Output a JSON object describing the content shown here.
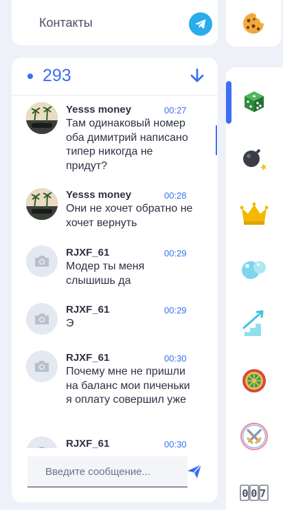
{
  "contacts": {
    "label": "Контакты"
  },
  "chat": {
    "online_count": "293",
    "messages": [
      {
        "user": "Yesss money",
        "time": "00:27",
        "text": "Там одинаковый номер оба димитрий написано типер никогда не придут?",
        "avatar": "photo"
      },
      {
        "user": "Yesss money",
        "time": "00:28",
        "text": "Они не хочет обратно не хочет вернуть",
        "avatar": "photo"
      },
      {
        "user": "RJXF_61",
        "time": "00:29",
        "text": "Модер ты меня слышишь да",
        "avatar": "camera-icon"
      },
      {
        "user": "RJXF_61",
        "time": "00:29",
        "text": "Э",
        "avatar": "camera-icon"
      },
      {
        "user": "RJXF_61",
        "time": "00:30",
        "text": "Почему мне не пришли на баланс мои пиченьки я оплату совершил уже",
        "avatar": "camera-icon"
      },
      {
        "user": "RJXF_61",
        "time": "00:30",
        "text": "",
        "avatar": "camera-icon"
      }
    ],
    "input_placeholder": "Введите сообщение..."
  },
  "games": [
    {
      "icon": "dice-icon",
      "active": true
    },
    {
      "icon": "bomb-icon",
      "active": false
    },
    {
      "icon": "crown-icon",
      "active": false
    },
    {
      "icon": "bubbles-icon",
      "active": false
    },
    {
      "icon": "crash-chart-icon",
      "active": false
    },
    {
      "icon": "roulette-wheel-icon",
      "active": false
    },
    {
      "icon": "crossed-swords-icon",
      "active": false
    },
    {
      "icon": "counter-digits-icon",
      "active": false
    }
  ],
  "counter_digits": "007",
  "colors": {
    "accent": "#3d6ef5",
    "telegram": "#2aabee",
    "background": "#eef1f8"
  }
}
